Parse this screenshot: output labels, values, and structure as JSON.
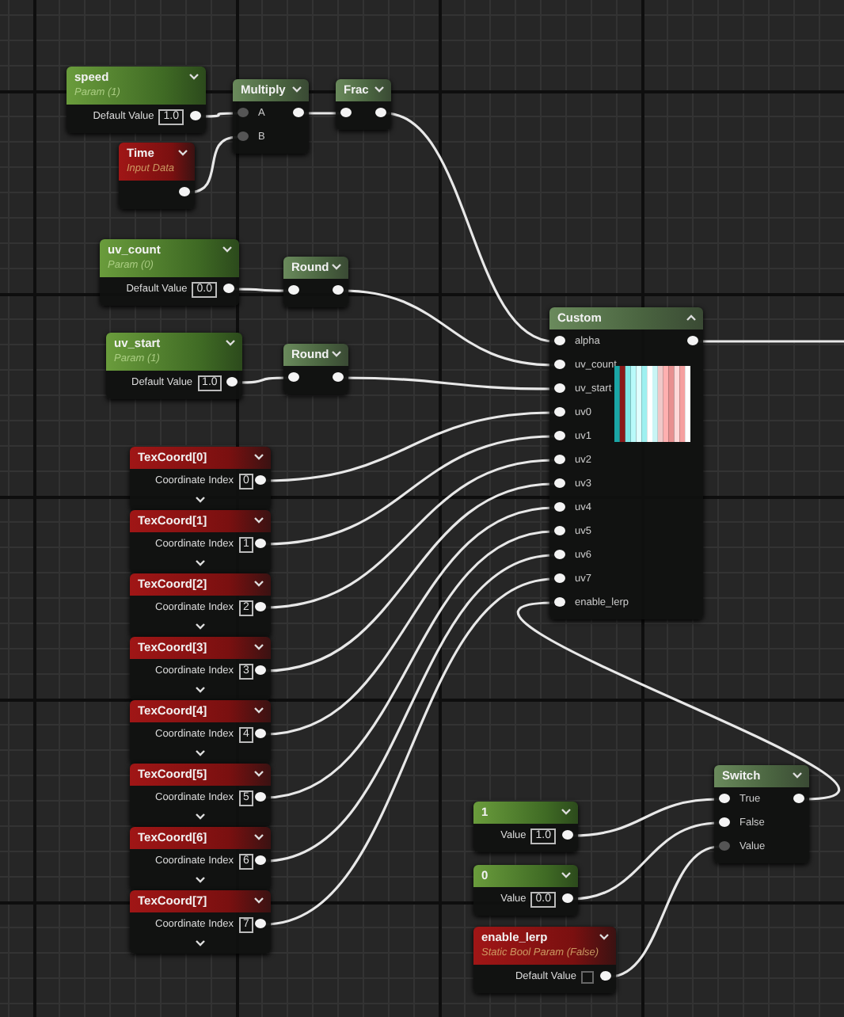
{
  "nodes": [
    {
      "kind": "scalar_param",
      "title": "speed",
      "subtitle": "Param (1)",
      "value_label": "Default Value",
      "value": "1.0",
      "expanded": false
    },
    {
      "kind": "input",
      "title": "Time",
      "subtitle": "Input Data",
      "expanded": false
    },
    {
      "kind": "function",
      "title": "Multiply",
      "inputs": [
        {
          "label": "A",
          "linked": false
        },
        {
          "label": "B",
          "linked": false
        }
      ],
      "expanded": false
    },
    {
      "kind": "function",
      "title": "Frac",
      "inputs": [
        {
          "linked": true
        }
      ],
      "expanded": false
    },
    {
      "kind": "scalar_param",
      "title": "uv_count",
      "subtitle": "Param (0)",
      "value_label": "Default Value",
      "value": "0.0",
      "expanded": false
    },
    {
      "kind": "function",
      "title": "Round",
      "inputs": [
        {
          "linked": true
        }
      ],
      "expanded": false
    },
    {
      "kind": "scalar_param",
      "title": "uv_start",
      "subtitle": "Param (1)",
      "value_label": "Default Value",
      "value": "1.0",
      "expanded": false
    },
    {
      "kind": "function",
      "title": "Round",
      "inputs": [
        {
          "linked": true
        }
      ],
      "expanded": false
    },
    {
      "kind": "custom",
      "title": "Custom",
      "expanded": true,
      "inputs": [
        {
          "label": "alpha",
          "linked": true
        },
        {
          "label": "uv_count",
          "linked": true
        },
        {
          "label": "uv_start",
          "linked": true
        },
        {
          "label": "uv0",
          "linked": true
        },
        {
          "label": "uv1",
          "linked": true
        },
        {
          "label": "uv2",
          "linked": true
        },
        {
          "label": "uv3",
          "linked": true
        },
        {
          "label": "uv4",
          "linked": true
        },
        {
          "label": "uv5",
          "linked": true
        },
        {
          "label": "uv6",
          "linked": true
        },
        {
          "label": "uv7",
          "linked": true
        },
        {
          "label": "enable_lerp",
          "linked": true
        }
      ]
    },
    {
      "kind": "texcoord",
      "title": "TexCoord[0]",
      "value_label": "Coordinate Index",
      "value": "0",
      "expanded": false
    },
    {
      "kind": "texcoord",
      "title": "TexCoord[1]",
      "value_label": "Coordinate Index",
      "value": "1",
      "expanded": false
    },
    {
      "kind": "texcoord",
      "title": "TexCoord[2]",
      "value_label": "Coordinate Index",
      "value": "2",
      "expanded": false
    },
    {
      "kind": "texcoord",
      "title": "TexCoord[3]",
      "value_label": "Coordinate Index",
      "value": "3",
      "expanded": false
    },
    {
      "kind": "texcoord",
      "title": "TexCoord[4]",
      "value_label": "Coordinate Index",
      "value": "4",
      "expanded": false
    },
    {
      "kind": "texcoord",
      "title": "TexCoord[5]",
      "value_label": "Coordinate Index",
      "value": "5",
      "expanded": false
    },
    {
      "kind": "texcoord",
      "title": "TexCoord[6]",
      "value_label": "Coordinate Index",
      "value": "6",
      "expanded": false
    },
    {
      "kind": "texcoord",
      "title": "TexCoord[7]",
      "value_label": "Coordinate Index",
      "value": "7",
      "expanded": false
    },
    {
      "kind": "function",
      "title": "Switch",
      "inputs": [
        {
          "label": "True",
          "linked": true
        },
        {
          "label": "False",
          "linked": true
        },
        {
          "label": "Value",
          "linked": false
        }
      ],
      "expanded": false
    },
    {
      "kind": "constant",
      "title": "1",
      "value_label": "Value",
      "value": "1.0",
      "expanded": false
    },
    {
      "kind": "constant",
      "title": "0",
      "value_label": "Value",
      "value": "0.0",
      "expanded": false
    },
    {
      "kind": "bool_param",
      "title": "enable_lerp",
      "subtitle": "Static Bool Param (False)",
      "value_label": "Default Value",
      "checked": false,
      "expanded": false
    }
  ]
}
